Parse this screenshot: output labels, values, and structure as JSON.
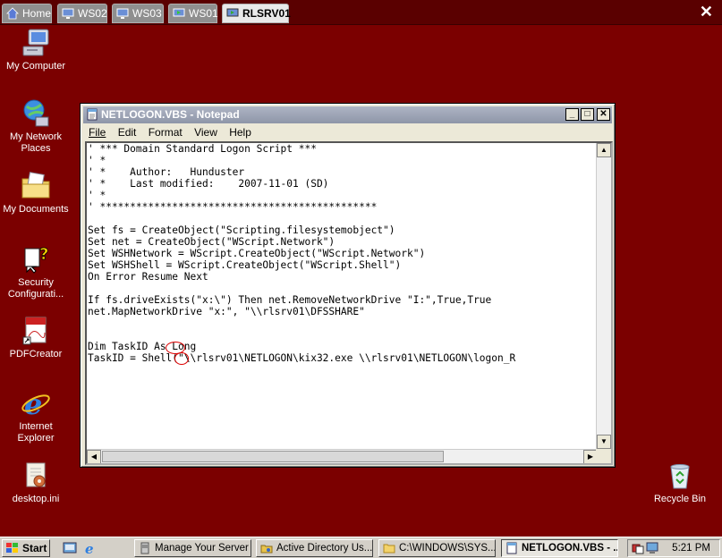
{
  "tabs": [
    {
      "label": "Home",
      "icon": "home-icon"
    },
    {
      "label": "WS02",
      "icon": "monitor-icon"
    },
    {
      "label": "WS03",
      "icon": "monitor-icon"
    },
    {
      "label": "WS01",
      "icon": "monitor-play-icon"
    },
    {
      "label": "RLSRV01",
      "icon": "monitor-play-icon",
      "active": true
    }
  ],
  "tab_close": "✕",
  "desktop_icons": [
    {
      "label": "My Computer",
      "icon": "computer-icon"
    },
    {
      "label": "My Network Places",
      "icon": "network-icon"
    },
    {
      "label": "My Documents",
      "icon": "folder-icon"
    },
    {
      "label": "Security Configurati...",
      "icon": "security-config-icon"
    },
    {
      "label": "PDFCreator",
      "icon": "pdf-icon"
    },
    {
      "label": "Internet Explorer",
      "icon": "ie-icon"
    },
    {
      "label": "desktop.ini",
      "icon": "ini-file-icon"
    },
    {
      "label": "Recycle Bin",
      "icon": "recycle-bin-icon"
    }
  ],
  "notepad": {
    "title": "NETLOGON.VBS - Notepad",
    "menu": [
      "File",
      "Edit",
      "Format",
      "View",
      "Help"
    ],
    "lines": [
      "' *** Domain Standard Logon Script ***",
      "' *",
      "' *    Author:   Hunduster",
      "' *    Last modified:    2007-11-01 (SD)",
      "' *",
      "' **********************************************",
      "",
      "Set fs = CreateObject(\"Scripting.filesystemobject\")",
      "Set net = CreateObject(\"WScript.Network\")",
      "Set WSHNetwork = WScript.CreateObject(\"WScript.Network\")",
      "Set WSHShell = WScript.CreateObject(\"WScript.Shell\")",
      "On Error Resume Next",
      "",
      "If fs.driveExists(\"x:\\\") Then net.RemoveNetworkDrive \"I:\",True,True",
      "net.MapNetworkDrive \"x:\", \"\\\\rlsrv01\\DFSSHARE\"",
      "",
      "",
      "Dim TaskID As Long",
      "TaskID = Shell(\"\\\\rlsrv01\\NETLOGON\\kix32.exe \\\\rlsrv01\\NETLOGON\\logon_R"
    ]
  },
  "taskbar": {
    "start_label": "Start",
    "quick_launch": [
      "desktop-icon",
      "ie-icon"
    ],
    "buttons": [
      {
        "label": "Manage Your Server",
        "icon": "server-icon"
      },
      {
        "label": "Active Directory Us...",
        "icon": "active-directory-icon"
      },
      {
        "label": "C:\\WINDOWS\\SYS...",
        "icon": "folder-icon"
      },
      {
        "label": "NETLOGON.VBS - ...",
        "icon": "notepad-icon",
        "active": true
      }
    ],
    "clock": "5:21 PM"
  }
}
